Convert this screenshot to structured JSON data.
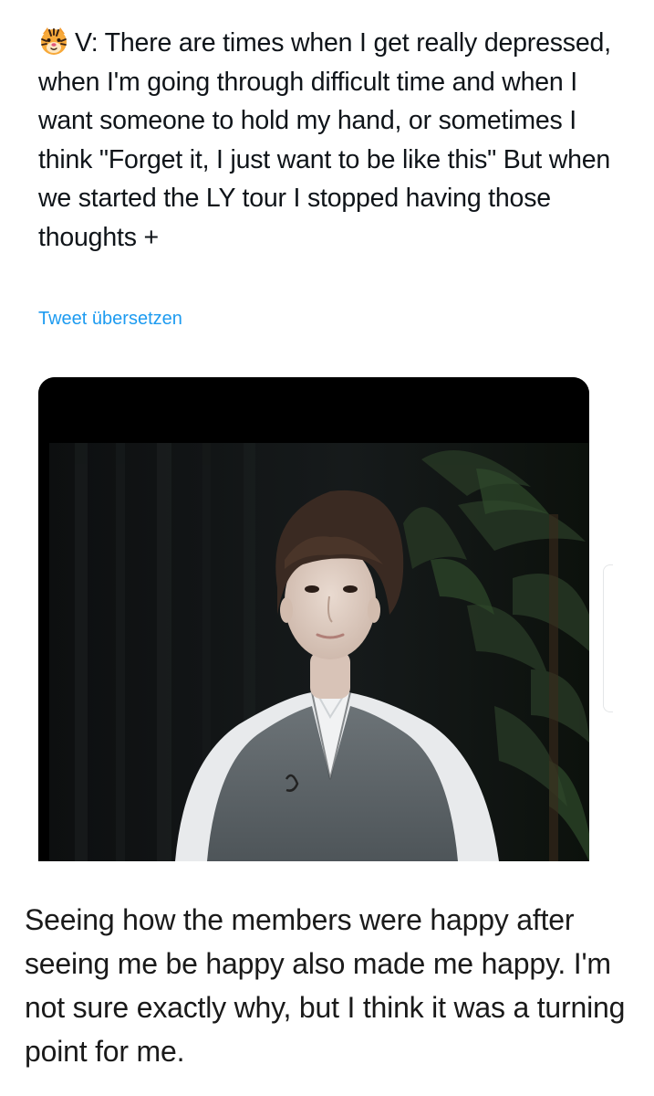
{
  "tweet": {
    "speaker": "V",
    "text": ": There are times when I get really depressed, when I'm going through difficult time and when I want someone to hold my hand, or sometimes I think \"Forget it, I just want to be like this\" But when we started the LY tour I stopped having those thoughts +",
    "emoji_icon": "tiger-face-icon",
    "translate_label": "Tweet übersetzen",
    "link_color": "#1d9bf0"
  },
  "media": {
    "type": "video-frame",
    "subject": "person-in-grey-vest-icon"
  },
  "caption": {
    "text": "Seeing how the members were happy after seeing me be happy also made me happy. I'm not sure exactly why, but I think it was a turning point for me."
  }
}
